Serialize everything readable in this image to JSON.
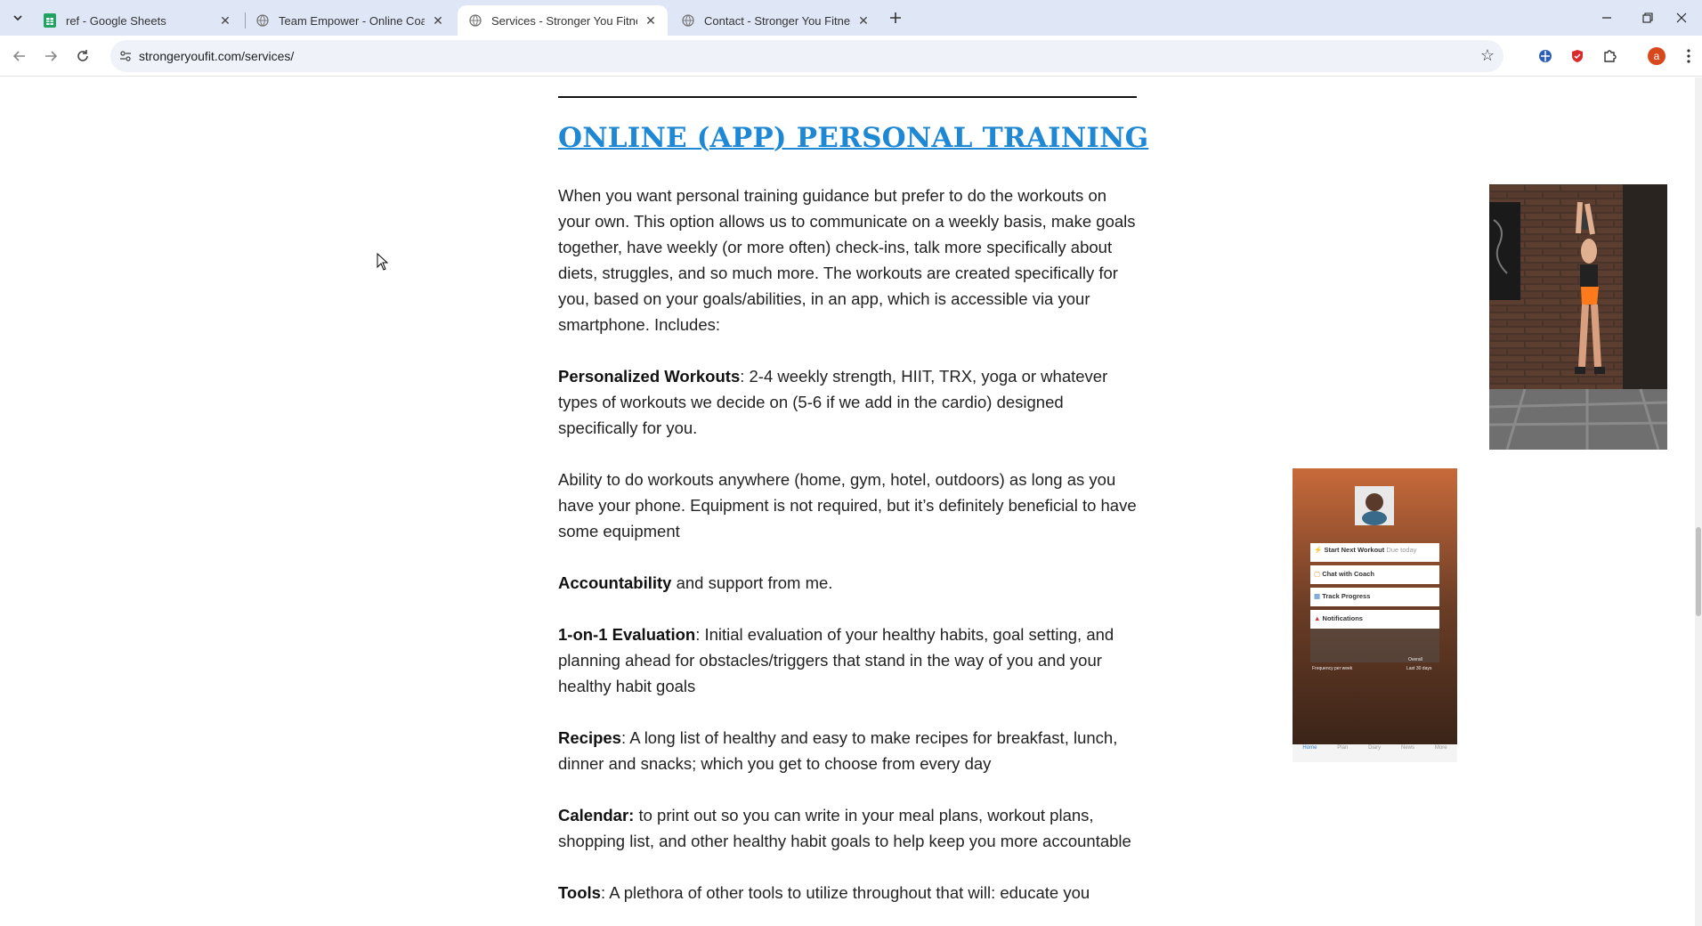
{
  "tabs": [
    {
      "title": "ref - Google Sheets",
      "icon": "sheets-icon",
      "active": false
    },
    {
      "title": "Team Empower - Online Coaching",
      "icon": "globe-icon",
      "active": false
    },
    {
      "title": "Services - Stronger You Fitness",
      "icon": "globe-icon",
      "active": true
    },
    {
      "title": "Contact - Stronger You Fitness",
      "icon": "globe-icon",
      "active": false
    }
  ],
  "toolbar": {
    "url": "strongeryoufit.com/services/",
    "profile_initial": "a"
  },
  "content": {
    "heading": "ONLINE (APP) PERSONAL TRAINING",
    "intro": "When you want personal training guidance but prefer to do the workouts on your own. This option allows us to communicate on a weekly basis, make goals together, have weekly (or more often) check-ins, talk more specifically about diets, struggles, and so much more. The workouts are created specifically for you, based on your goals/abilities, in an app, which is accessible via  your smartphone. Includes:",
    "items": [
      {
        "label": "Personalized Workouts",
        "sep": ": ",
        "text": "2-4 weekly strength, HIIT, TRX, yoga or whatever types of workouts we decide on (5-6 if we add in the cardio) designed specifically for you."
      },
      {
        "label": "",
        "sep": "",
        "text": "Ability to do workouts anywhere (home, gym, hotel, outdoors) as long as you have your phone. Equipment is not required, but it’s definitely beneficial to have some equipment"
      },
      {
        "label": "Accountability",
        "sep": " ",
        "text": "and support from me."
      },
      {
        "label": "1-on-1 Evaluation",
        "sep": ": ",
        "text": "Initial evaluation of your healthy habits, goal setting, and planning ahead for obstacles/triggers that stand in the way of you and your healthy habit goals"
      },
      {
        "label": "Recipes",
        "sep": ": ",
        "text": "A long list of healthy and easy to make recipes for breakfast, lunch, dinner and snacks; which you get to choose from every day"
      },
      {
        "label": "Calendar:",
        "sep": " ",
        "text": "to print out so you can write in your meal plans, workout plans, shopping list, and other healthy habit goals to help keep you more accountable"
      },
      {
        "label": "Tools",
        "sep": ": ",
        "text": "A plethora of other tools to utilize throughout that will: educate you"
      }
    ]
  },
  "app_screen": {
    "buttons": [
      "Start Next Workout",
      "Chat with Coach",
      "Track Progress",
      "Notifications"
    ],
    "start_sub": "Due today",
    "stats": [
      "Frequency per week",
      "Last 30 days",
      "Overall"
    ],
    "nav": [
      "Home",
      "Plan",
      "Diary",
      "News",
      "More"
    ]
  },
  "colors": {
    "heading": "#1e88d4",
    "tabstrip": "#dfe7f7"
  }
}
